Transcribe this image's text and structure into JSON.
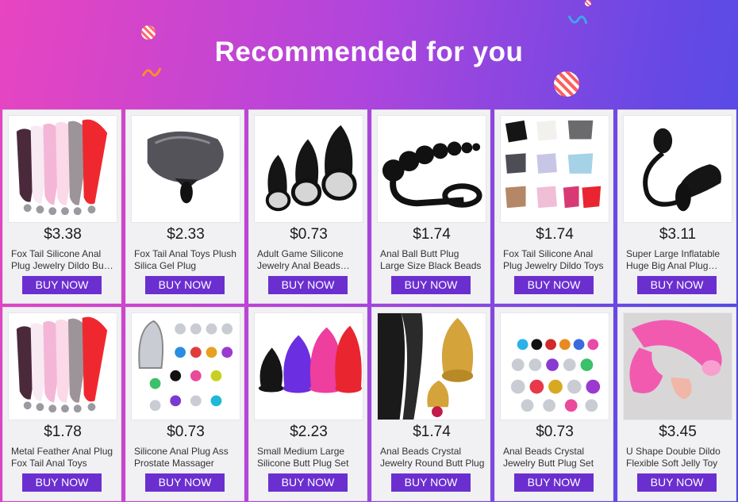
{
  "banner": {
    "title": "Recommended for you"
  },
  "products": [
    {
      "price": "$3.38",
      "title": "Fox Tail Silicone Anal Plug Jewelry Dildo Butt Plug",
      "button": "BUY NOW",
      "image": "fox-tails-rainbow"
    },
    {
      "price": "$2.33",
      "title": "Fox Tail Anal Toys Plush Silica Gel Plug",
      "button": "BUY NOW",
      "image": "grey-fox-tail"
    },
    {
      "price": "$0.73",
      "title": "Adult Game Silicone Jewelry Anal Beads Plug",
      "button": "BUY NOW",
      "image": "black-jeweled-plugs"
    },
    {
      "price": "$1.74",
      "title": "Anal Ball Butt Plug Large Size Black Beads",
      "button": "BUY NOW",
      "image": "black-anal-beads"
    },
    {
      "price": "$1.74",
      "title": "Fox Tail Silicone Anal Plug Jewelry Dildo Toys",
      "button": "BUY NOW",
      "image": "fox-tails-assorted"
    },
    {
      "price": "$3.11",
      "title": "Super Large Inflatable Huge Big Anal Plug Pump",
      "button": "BUY NOW",
      "image": "inflatable-plug"
    },
    {
      "price": "$1.78",
      "title": "Metal Feather Anal Plug Fox Tail Anal Toys",
      "button": "BUY NOW",
      "image": "fox-tails-rainbow"
    },
    {
      "price": "$0.73",
      "title": "Silicone Anal Plug Ass Prostate Massager",
      "button": "BUY NOW",
      "image": "metal-jeweled-plugs"
    },
    {
      "price": "$2.23",
      "title": "Small Medium Large Silicone Butt Plug Set",
      "button": "BUY NOW",
      "image": "colored-plugs"
    },
    {
      "price": "$1.74",
      "title": "Anal Beads Crystal Jewelry Round Butt Plug",
      "button": "BUY NOW",
      "image": "gold-plug"
    },
    {
      "price": "$0.73",
      "title": "Anal Beads Crystal Jewelry Butt Plug Set",
      "button": "BUY NOW",
      "image": "metal-plug-grid"
    },
    {
      "price": "$3.45",
      "title": "U Shape Double Dildo Flexible Soft Jelly Toy",
      "button": "BUY NOW",
      "image": "pink-double-dildo"
    }
  ]
}
